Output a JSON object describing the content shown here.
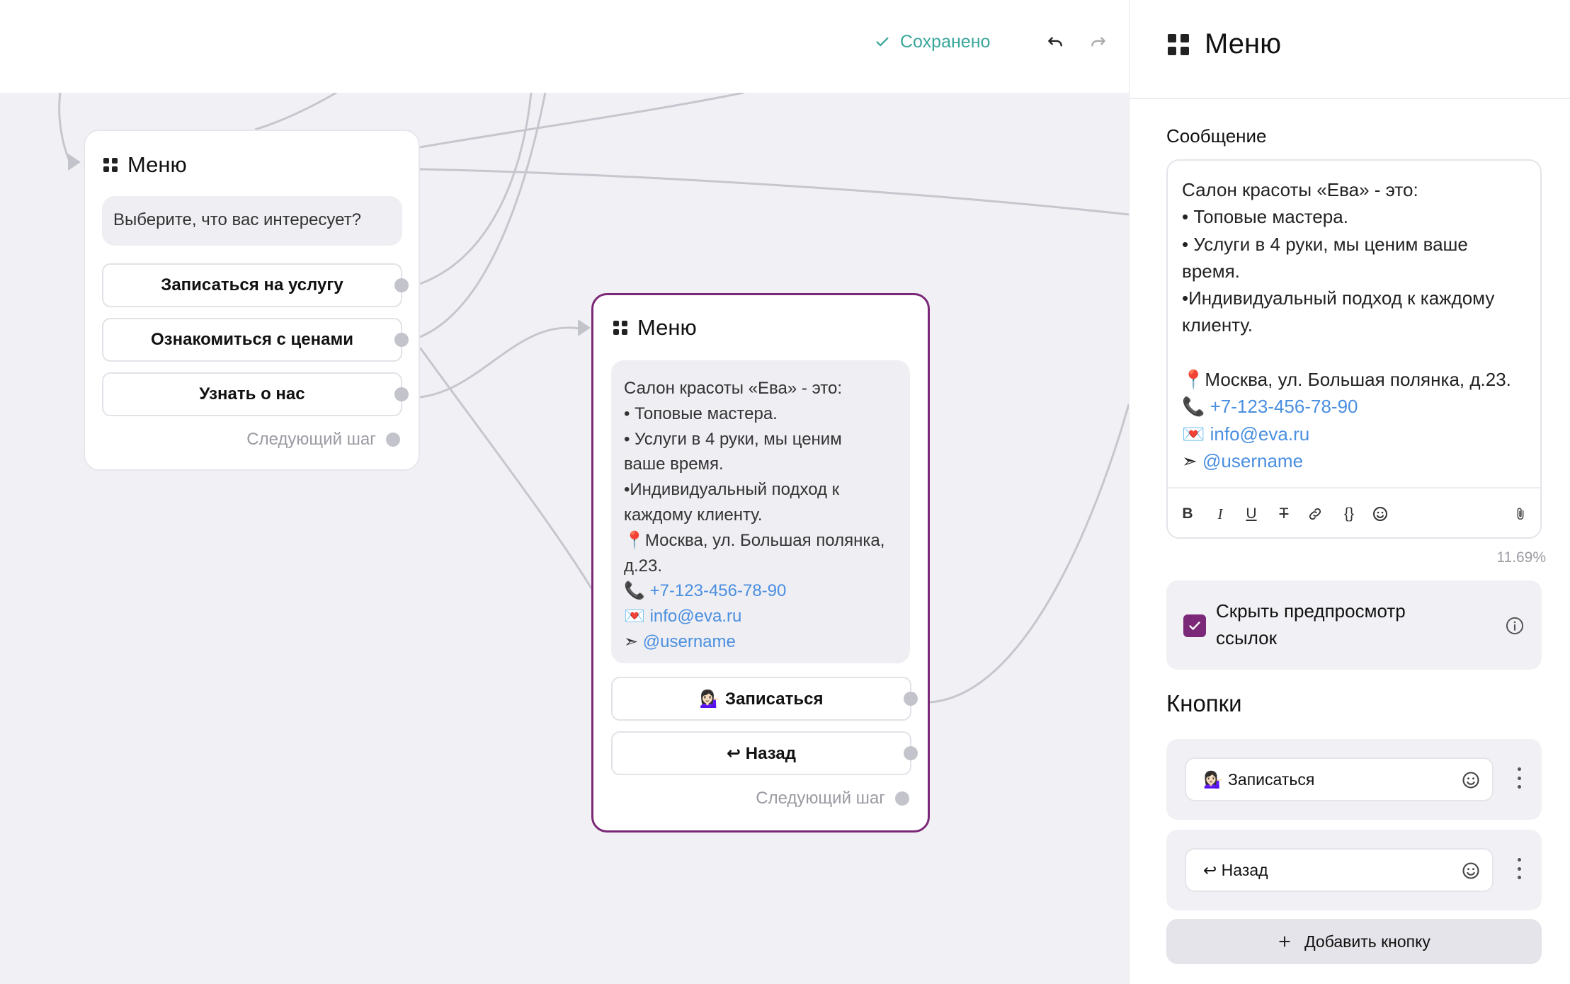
{
  "topbar": {
    "saved_label": "Сохранено",
    "undo_icon": "undo-icon",
    "redo_icon": "redo-icon",
    "saved_color": "#3aa79b"
  },
  "node1": {
    "title": "Меню",
    "message": "Выберите, что вас интересует?",
    "buttons": [
      "Записаться на услугу",
      "Ознакомиться с ценами",
      "Узнать о нас"
    ],
    "next_step": "Следующий шаг"
  },
  "node2": {
    "title": "Меню",
    "message_lines": [
      "Салон красоты «Ева» - это:",
      "• Топовые мастера.",
      "• Услуги в 4 руки, мы ценим",
      "ваше время.",
      "•Индивидуальный подход к",
      "каждому клиенту.",
      "📍Москва, ул. Большая полянка,",
      "д.23."
    ],
    "phone_prefix": "📞 ",
    "phone": "+7-123-456-78-90",
    "email_prefix": "💌 ",
    "email": "info@eva.ru",
    "tg_prefix": "➣ ",
    "username": "@username",
    "buttons": [
      "💁🏻‍♀️ Записаться",
      "↩ Назад"
    ],
    "next_step": "Следующий шаг",
    "border_color": "#7a2877"
  },
  "panel": {
    "title": "Меню",
    "message_label": "Сообщение",
    "editor_text_lines": [
      "Салон красоты «Ева» - это:",
      "• Топовые мастера.",
      "• Услуги в 4 руки, мы ценим ваше",
      "время.",
      "•Индивидуальный подход к каждому",
      "клиенту.",
      "",
      "📍Москва, ул. Большая полянка, д.23."
    ],
    "phone_prefix": "📞 ",
    "phone": "+7-123-456-78-90",
    "email_prefix": "💌 ",
    "email": "info@eva.ru",
    "tg_prefix": "➣ ",
    "username": "@username",
    "toolbar": {
      "bold": "B",
      "italic": "I",
      "underline": "U",
      "strike": "T",
      "braces": "{}"
    },
    "percent": "11.69%",
    "hide_preview_label": "Скрыть предпросмотр ссылок",
    "hide_preview_checked": true,
    "buttons_title": "Кнопки",
    "buttons": [
      "💁🏻‍♀️ Записаться",
      "↩ Назад"
    ],
    "add_button_label": "Добавить кнопку",
    "accent_color": "#7a2877",
    "link_color": "#4a8fe0"
  }
}
